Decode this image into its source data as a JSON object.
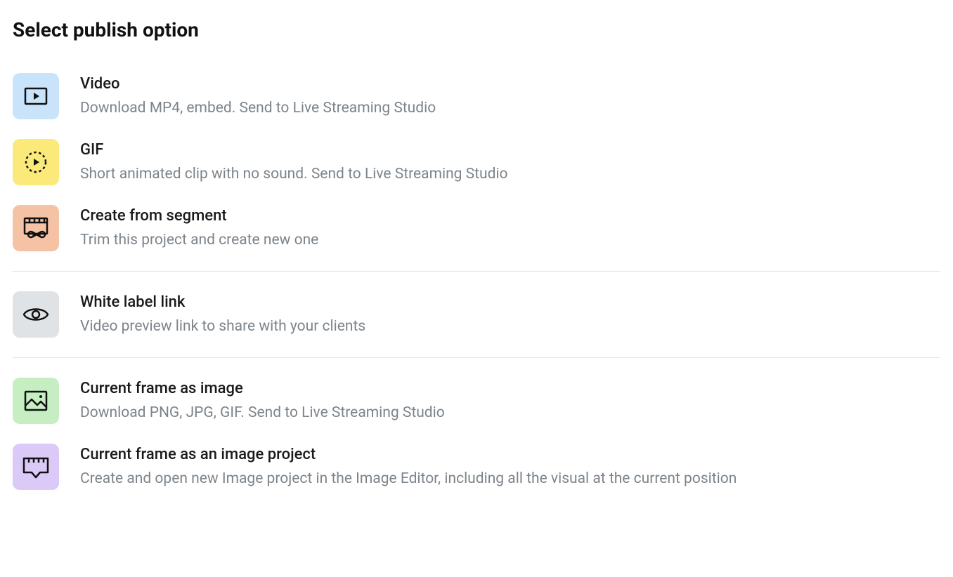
{
  "heading": "Select publish option",
  "groups": [
    {
      "items": [
        {
          "id": "video",
          "icon_bg": "bg-blue",
          "title": "Video",
          "desc": "Download MP4, embed. Send to Live Streaming Studio"
        },
        {
          "id": "gif",
          "icon_bg": "bg-yellow",
          "title": "GIF",
          "desc": "Short animated clip with no sound. Send to Live Streaming Studio"
        },
        {
          "id": "segment",
          "icon_bg": "bg-coral",
          "title": "Create from segment",
          "desc": "Trim this project and create new one"
        }
      ]
    },
    {
      "items": [
        {
          "id": "whitelabel",
          "icon_bg": "bg-gray",
          "title": "White label link",
          "desc": "Video preview link to share with your clients"
        }
      ]
    },
    {
      "items": [
        {
          "id": "frame-image",
          "icon_bg": "bg-green",
          "title": "Current frame as image",
          "desc": "Download PNG, JPG, GIF. Send to Live Streaming Studio"
        },
        {
          "id": "frame-project",
          "icon_bg": "bg-purple",
          "title": "Current frame as an image project",
          "desc": "Create and open new Image project in the Image Editor, including all the visual at the current position"
        }
      ]
    }
  ]
}
